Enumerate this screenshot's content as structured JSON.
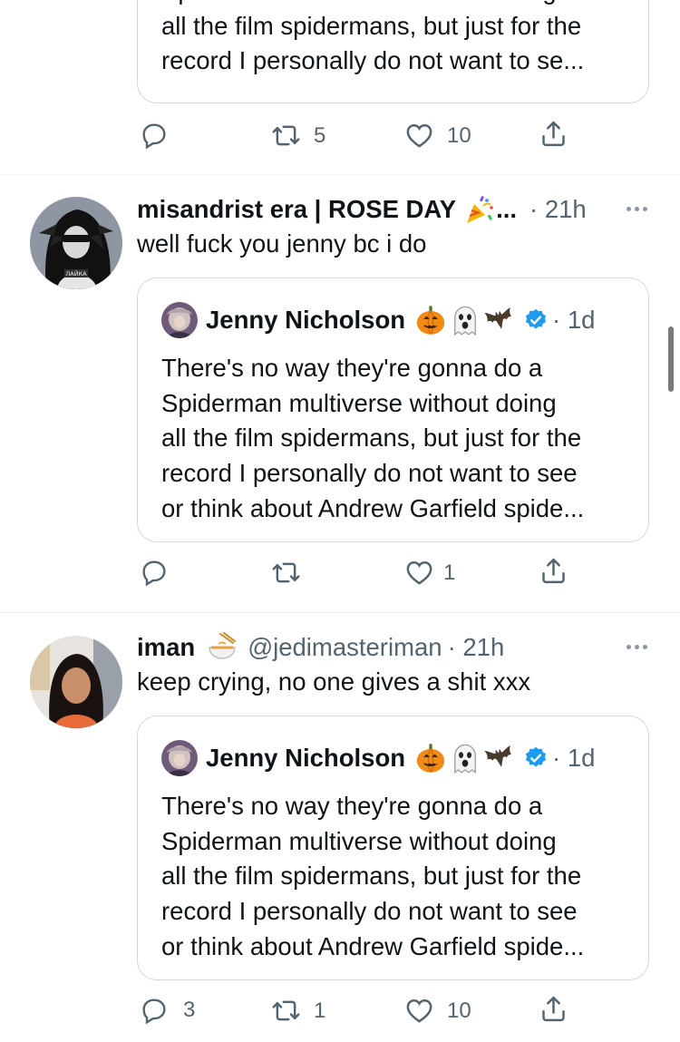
{
  "quote_text_lines": [
    "There's no way they're gonna do a",
    "Spiderman multiverse without doing",
    "all the film spidermans, but just for the",
    "record I personally do not want to see",
    "or think about Andrew Garfield spide..."
  ],
  "top_quote": {
    "visible_lines": [
      "Spiderman multiverse without doing",
      "all the film spidermans, but just for the",
      "record I personally do not want to se..."
    ]
  },
  "top_actions": {
    "reply": "",
    "retweet": "5",
    "like": "10"
  },
  "tweets": [
    {
      "display_name": "misandrist era | ROSE DAY",
      "name_emoji": "party-popper",
      "ellipsis": "...",
      "time": "· 21h",
      "text": "well fuck you jenny bc i do",
      "quote": {
        "name": "Jenny Nicholson",
        "emojis": [
          "jack-o-lantern",
          "ghost",
          "bat"
        ],
        "time": "· 1d"
      },
      "actions": {
        "reply": "",
        "retweet": "",
        "like": "1"
      }
    },
    {
      "display_name": "iman",
      "name_emoji": "bowl-with-chopsticks",
      "handle": "@jedimasteriman",
      "time": "· 21h",
      "text": "keep crying, no one gives a shit xxx",
      "quote": {
        "name": "Jenny Nicholson",
        "emojis": [
          "jack-o-lantern",
          "ghost",
          "bat"
        ],
        "time": "· 1d"
      },
      "actions": {
        "reply": "3",
        "retweet": "1",
        "like": "10"
      }
    }
  ],
  "colors": {
    "text": "#0f1419",
    "secondary": "#536471",
    "border": "#cfd9de",
    "verified": "#1d9bf0"
  }
}
